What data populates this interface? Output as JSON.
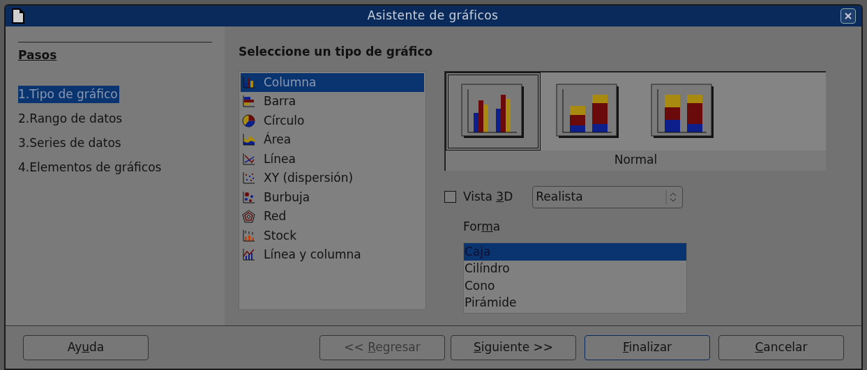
{
  "window": {
    "title": "Asistente de gráficos"
  },
  "steps": {
    "title": "Pasos",
    "items": [
      {
        "label": "1.Tipo de gráfico",
        "selected": true
      },
      {
        "label": "2.Rango de datos",
        "selected": false
      },
      {
        "label": "3.Series de datos",
        "selected": false
      },
      {
        "label": "4.Elementos de gráficos",
        "selected": false
      }
    ]
  },
  "heading": "Seleccione un tipo de gráfico",
  "chart_types": [
    {
      "kind": "column",
      "label": "Columna",
      "selected": true
    },
    {
      "kind": "bar",
      "label": "Barra",
      "selected": false
    },
    {
      "kind": "pie",
      "label": "Círculo",
      "selected": false
    },
    {
      "kind": "area",
      "label": "Área",
      "selected": false
    },
    {
      "kind": "line",
      "label": "Línea",
      "selected": false
    },
    {
      "kind": "xy",
      "label": "XY (dispersión)",
      "selected": false
    },
    {
      "kind": "bubble",
      "label": "Burbuja",
      "selected": false
    },
    {
      "kind": "net",
      "label": "Red",
      "selected": false
    },
    {
      "kind": "stock",
      "label": "Stock",
      "selected": false
    },
    {
      "kind": "linecolumn",
      "label": "Línea y columna",
      "selected": false
    }
  ],
  "variants": {
    "items": [
      {
        "kind": "grouped",
        "selected": true
      },
      {
        "kind": "stacked",
        "selected": false
      },
      {
        "kind": "percent",
        "selected": false
      }
    ],
    "caption": "Normal"
  },
  "view_3d": {
    "label": {
      "lead": "Vista ",
      "key": "3",
      "rest": "D"
    },
    "checked": false,
    "style": "Realista"
  },
  "shape": {
    "label": {
      "lead": "For",
      "key": "m",
      "rest": "a"
    },
    "items": [
      {
        "label": "Caja",
        "selected": true
      },
      {
        "label": "Cilíndro",
        "selected": false
      },
      {
        "label": "Cono",
        "selected": false
      },
      {
        "label": "Pirámide",
        "selected": false
      }
    ]
  },
  "buttons": [
    {
      "label": {
        "lead": "Ay",
        "key": "u",
        "rest": "da"
      },
      "disabled": false,
      "focused": false
    },
    {
      "label": {
        "lead": "<< ",
        "key": "R",
        "rest": "egresar"
      },
      "disabled": true,
      "focused": false
    },
    {
      "label": {
        "key": "S",
        "rest": "iguiente >>"
      },
      "disabled": false,
      "focused": false
    },
    {
      "label": {
        "key": "F",
        "rest": "inalizar"
      },
      "disabled": false,
      "focused": true
    },
    {
      "label": {
        "key": "C",
        "rest": "ancelar"
      },
      "disabled": false,
      "focused": false
    }
  ]
}
